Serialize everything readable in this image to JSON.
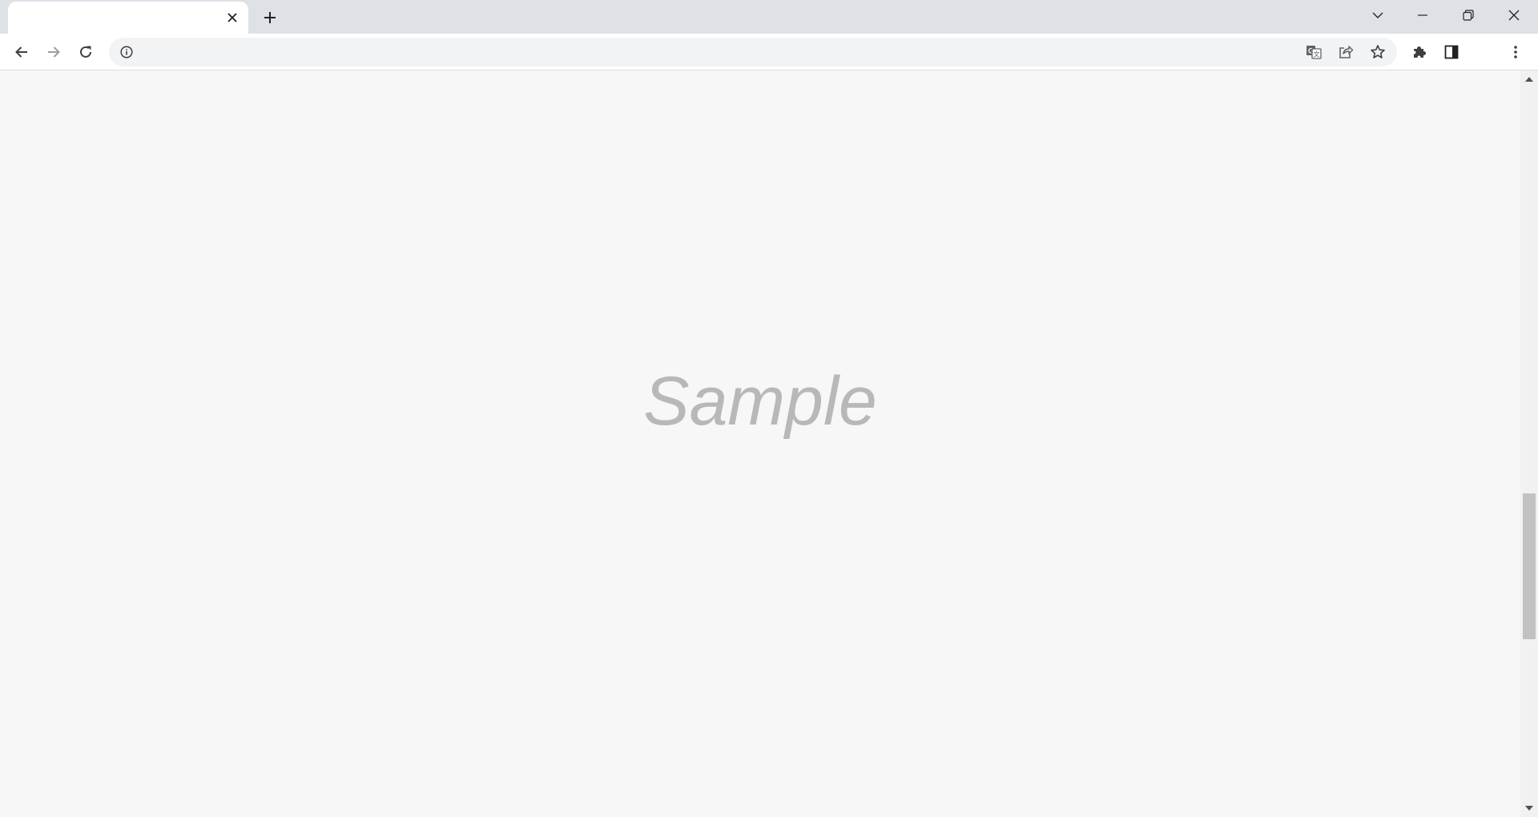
{
  "tab": {
    "title": "",
    "close_icon": "close-icon"
  },
  "tabstrip": {
    "new_tab_icon": "plus-icon",
    "tab_search_icon": "chevron-down-icon",
    "minimize_icon": "minimize-icon",
    "restore_icon": "restore-icon",
    "close_window_icon": "close-window-icon"
  },
  "toolbar": {
    "back_icon": "back-arrow-icon",
    "forward_icon": "forward-arrow-icon",
    "reload_icon": "reload-icon",
    "address": {
      "value": "",
      "site_info_icon": "info-icon"
    },
    "translate_icon": "translate-icon",
    "share_icon": "share-icon",
    "bookmark_icon": "star-icon",
    "extensions_icon": "puzzle-icon",
    "side_panel_icon": "side-panel-icon",
    "menu_icon": "kebab-menu-icon"
  },
  "content": {
    "watermark": "Sample",
    "background_color": "#f7f7f7",
    "watermark_color": "#b8b8b8"
  },
  "scrollbar": {
    "position_fraction": 0.56
  }
}
